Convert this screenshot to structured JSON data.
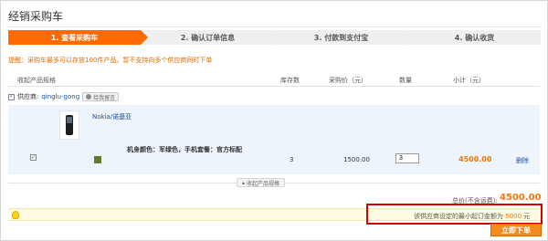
{
  "page": {
    "title": "经销采购车"
  },
  "steps": [
    {
      "label": "1. 查看采购车",
      "active": true
    },
    {
      "label": "2. 确认订单信息",
      "active": false
    },
    {
      "label": "3. 付款到支付宝",
      "active": false
    },
    {
      "label": "4. 确认收货",
      "active": false
    }
  ],
  "notice": "提醒：采购车最多可以存放100件产品，暂不支持向多个供应商同时下单",
  "table_header": {
    "collapse_specs": "收起产品规格",
    "stock": "库存数",
    "price": "采购价（元）",
    "quantity": "数量",
    "subtotal": "小计（元）"
  },
  "supplier": {
    "label": "供应商:",
    "name": "qinglu-gong",
    "message_button": "给我留言"
  },
  "product": {
    "name": "Nokia/诺基亚",
    "spec": "机身颜色：军绿色，手机套餐：官方标配",
    "swatch_color": "#5e7a2e",
    "stock": "3",
    "price": "1500.00",
    "quantity": "3",
    "subtotal": "4500.00",
    "delete": "删除"
  },
  "collapse_button": "收起产品规格",
  "total": {
    "label": "总价(不含运费):",
    "value": "4500.00"
  },
  "min_order": {
    "text": "该供应商设定的最小起订金额为",
    "amount": "5000",
    "unit": "元"
  },
  "order_button": "立即下单"
}
